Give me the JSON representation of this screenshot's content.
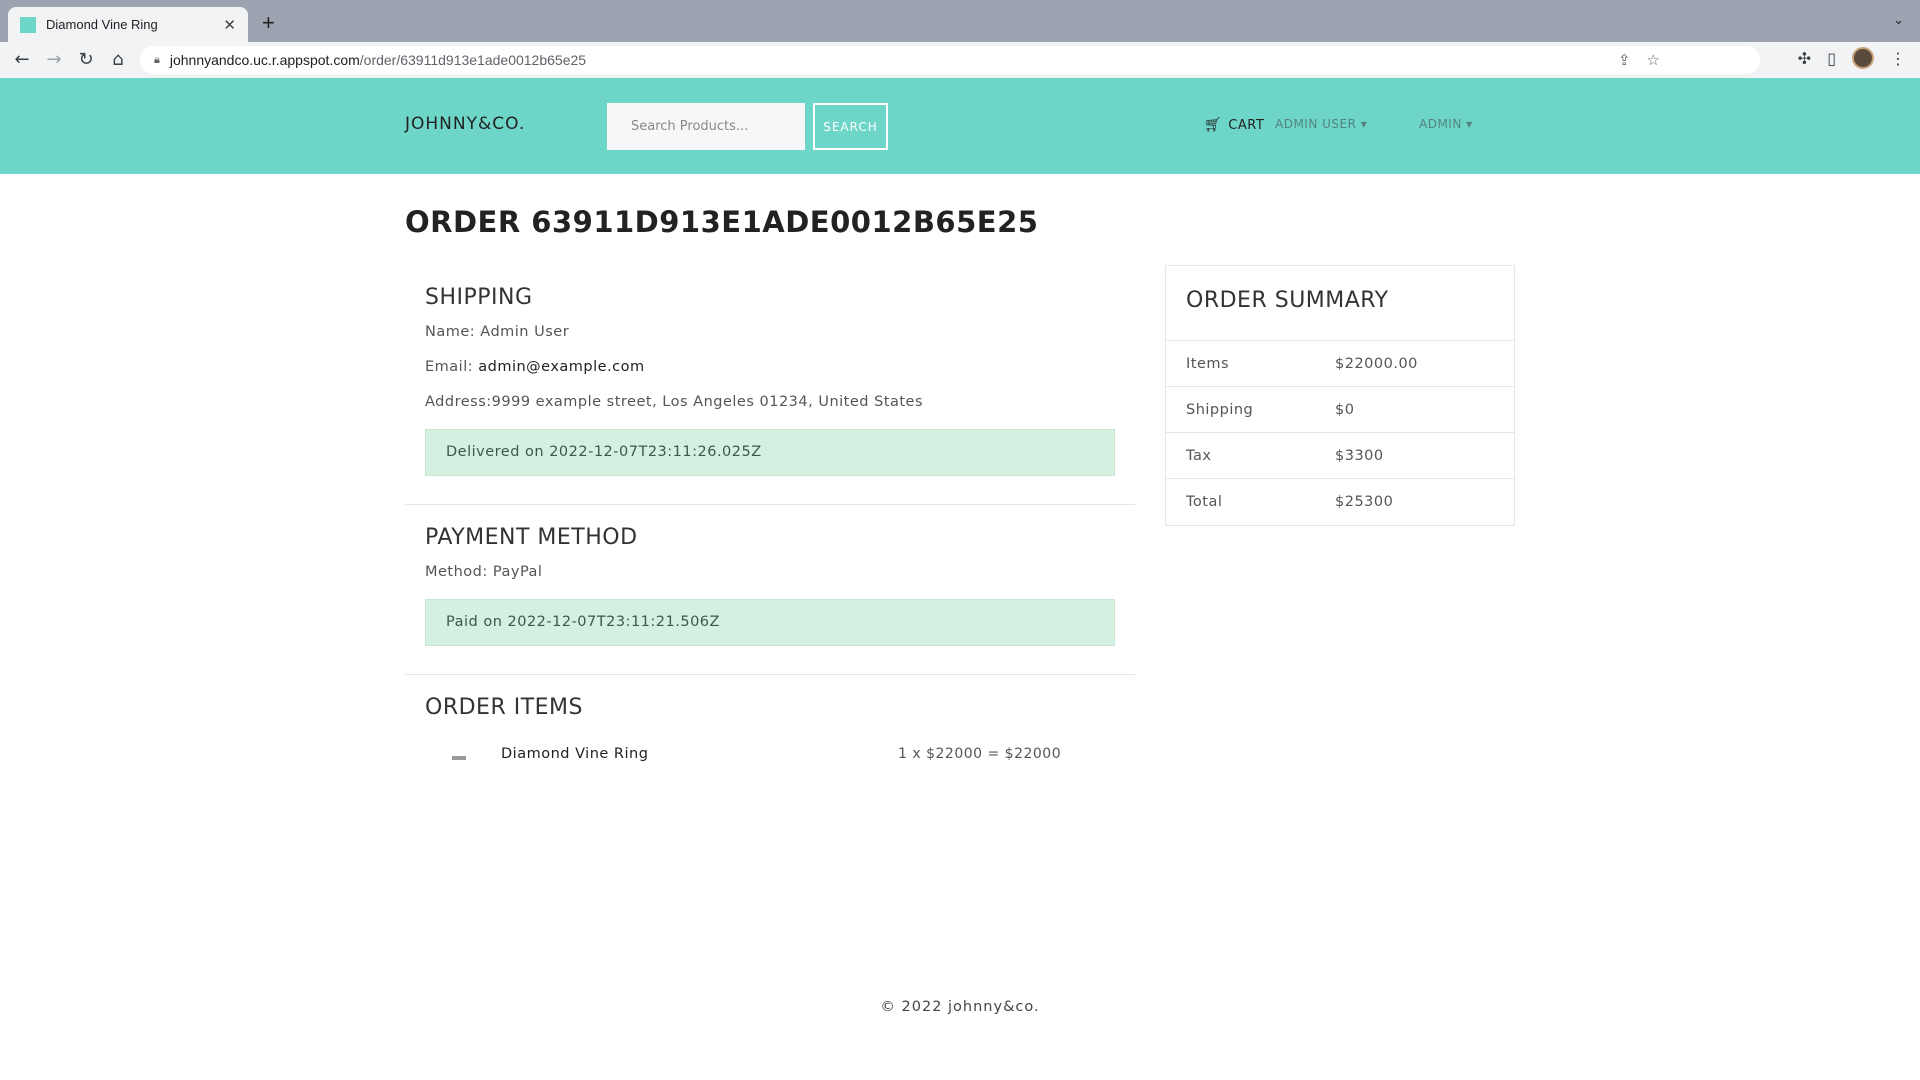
{
  "browser": {
    "tab_title": "Diamond Vine Ring",
    "url_host": "johnnyandco.uc.r.appspot.com",
    "url_path": "/order/63911d913e1ade0012b65e25"
  },
  "header": {
    "brand": "JOHNNY&CO.",
    "search_placeholder": "Search Products...",
    "search_button": "SEARCH",
    "cart_label": "CART",
    "user_menu": "ADMIN USER ▾",
    "admin_menu": "ADMIN ▾"
  },
  "order": {
    "title": "ORDER 63911D913E1ADE0012B65E25",
    "shipping": {
      "heading": "SHIPPING",
      "name_label": "Name: ",
      "name": "Admin User",
      "email_label": "Email: ",
      "email": "admin@example.com",
      "address_label": "Address:",
      "address": "9999 example street, Los Angeles 01234, United States",
      "status": "Delivered on 2022-12-07T23:11:26.025Z"
    },
    "payment": {
      "heading": "PAYMENT METHOD",
      "method_label": "Method: ",
      "method": "PayPal",
      "status": "Paid on 2022-12-07T23:11:21.506Z"
    },
    "items": {
      "heading": "ORDER ITEMS",
      "list": [
        {
          "name": "Diamond Vine Ring",
          "price_line": "1 x $22000 = $22000"
        }
      ]
    }
  },
  "summary": {
    "heading": "ORDER SUMMARY",
    "rows": [
      {
        "label": "Items",
        "value": "$22000.00"
      },
      {
        "label": "Shipping",
        "value": "$0"
      },
      {
        "label": "Tax",
        "value": "$3300"
      },
      {
        "label": "Total",
        "value": "$25300"
      }
    ]
  },
  "footer": {
    "copyright": "© 2022 johnny&co."
  },
  "colors": {
    "header_bg": "#6dd6c8",
    "alert_bg": "#d4f0e1"
  }
}
